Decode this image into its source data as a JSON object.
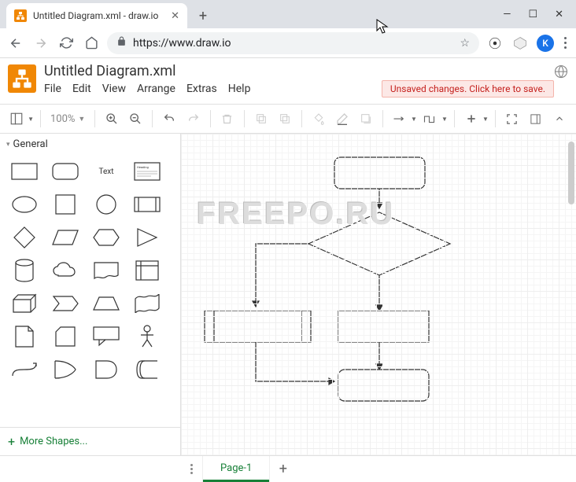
{
  "browser": {
    "tab_title": "Untitled Diagram.xml - draw.io",
    "url": "https://www.draw.io",
    "avatar_letter": "K"
  },
  "app": {
    "title": "Untitled Diagram.xml",
    "menu": {
      "file": "File",
      "edit": "Edit",
      "view": "View",
      "arrange": "Arrange",
      "extras": "Extras",
      "help": "Help"
    },
    "unsaved_msg": "Unsaved changes. Click here to save."
  },
  "toolbar": {
    "zoom": "100%"
  },
  "sidebar": {
    "category": "General",
    "text_label": "Text",
    "heading_label": "Heading",
    "more_shapes": "More Shapes..."
  },
  "watermark": "FREEPO.RU",
  "pages": {
    "page1": "Page-1"
  }
}
